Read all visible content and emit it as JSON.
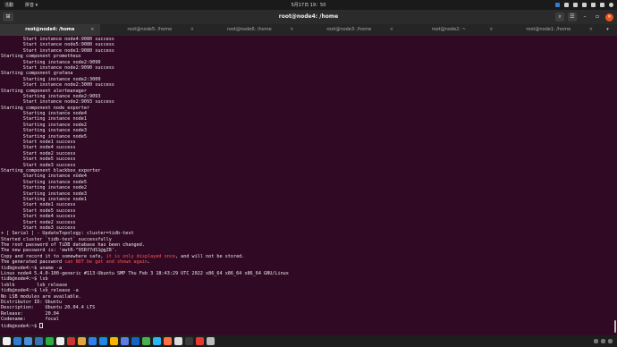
{
  "topbar": {
    "activities": "活動",
    "ime": "拼音 ▾",
    "clock": "5月17日 19：50",
    "tray_icons": [
      {
        "name": "app-tray-icon",
        "color": "#2e7fd6"
      },
      {
        "name": "chat-icon",
        "color": "#cfcfcf"
      },
      {
        "name": "wifi-icon",
        "color": "#cfcfcf"
      },
      {
        "name": "bluetooth-icon",
        "color": "#cfcfcf"
      },
      {
        "name": "volume-icon",
        "color": "#cfcfcf"
      },
      {
        "name": "battery-icon",
        "color": "#cfcfcf"
      },
      {
        "name": "power-icon",
        "color": "#cfcfcf"
      }
    ]
  },
  "window": {
    "title": "root@node4: /home",
    "new_tab_icon": "⊞",
    "search_icon": "⌕",
    "menu_icon": "☰",
    "minimize_icon": "–",
    "maximize_icon": "▫",
    "close_icon": "✕"
  },
  "tabs": [
    {
      "label": "root@node4: /home",
      "active": true
    },
    {
      "label": "root@node5: /home",
      "active": false
    },
    {
      "label": "root@node6: /home",
      "active": false
    },
    {
      "label": "root@node3: /home",
      "active": false
    },
    {
      "label": "root@node2: ~",
      "active": false
    },
    {
      "label": "root@node1: /home",
      "active": false
    }
  ],
  "tab_close_icon": "×",
  "tab_menu_icon": "▾",
  "terminal": {
    "lines": [
      [
        {
          "t": "        Start instance node4:9080 success"
        }
      ],
      [
        {
          "t": "        Start instance node5:9080 success"
        }
      ],
      [
        {
          "t": "        Start instance node1:9080 success"
        }
      ],
      [
        {
          "t": "Starting component prometheus"
        }
      ],
      [
        {
          "t": "        Starting instance node2:9090"
        }
      ],
      [
        {
          "t": "        Start instance node2:9090 success"
        }
      ],
      [
        {
          "t": "Starting component grafana"
        }
      ],
      [
        {
          "t": "        Starting instance node2:3000"
        }
      ],
      [
        {
          "t": "        Start instance node2:3000 success"
        }
      ],
      [
        {
          "t": "Starting component alertmanager"
        }
      ],
      [
        {
          "t": "        Starting instance node2:9093"
        }
      ],
      [
        {
          "t": "        Start instance node2:9093 success"
        }
      ],
      [
        {
          "t": "Starting component node_exporter"
        }
      ],
      [
        {
          "t": "        Starting instance node4"
        }
      ],
      [
        {
          "t": "        Starting instance node1"
        }
      ],
      [
        {
          "t": "        Starting instance node2"
        }
      ],
      [
        {
          "t": "        Starting instance node3"
        }
      ],
      [
        {
          "t": "        Starting instance node5"
        }
      ],
      [
        {
          "t": "        Start node1 success"
        }
      ],
      [
        {
          "t": "        Start node4 success"
        }
      ],
      [
        {
          "t": "        Start node2 success"
        }
      ],
      [
        {
          "t": "        Start node5 success"
        }
      ],
      [
        {
          "t": "        Start node3 success"
        }
      ],
      [
        {
          "t": "Starting component blackbox_exporter"
        }
      ],
      [
        {
          "t": "        Starting instance node4"
        }
      ],
      [
        {
          "t": "        Starting instance node5"
        }
      ],
      [
        {
          "t": "        Starting instance node2"
        }
      ],
      [
        {
          "t": "        Starting instance node3"
        }
      ],
      [
        {
          "t": "        Starting instance node1"
        }
      ],
      [
        {
          "t": "        Start node1 success"
        }
      ],
      [
        {
          "t": "        Start node5 success"
        }
      ],
      [
        {
          "t": "        Start node4 success"
        }
      ],
      [
        {
          "t": "        Start node2 success"
        }
      ],
      [
        {
          "t": "        Start node3 success"
        }
      ],
      [
        {
          "t": "+ [ Serial ] - UpdateTopology: cluster=tidb-test"
        }
      ],
      [
        {
          "t": "Started cluster `tidb-test` successfully"
        }
      ],
      [
        {
          "t": "The root password of TiDB database has been changed."
        }
      ],
      [
        {
          "t": "The new password is: 'ewtR-^95Rf7dS1@gZ8'."
        }
      ],
      [
        {
          "t": "Copy and record it to somewhere safe, "
        },
        {
          "t": "it is only displayed once",
          "red": true
        },
        {
          "t": ", and will not be stored."
        }
      ],
      [
        {
          "t": "The generated password "
        },
        {
          "t": "can NOT be get and shown again",
          "red": true
        },
        {
          "t": "."
        }
      ],
      [
        {
          "t": "tidb@node4:~$ uname -a"
        }
      ],
      [
        {
          "t": "Linux node4 5.4.0-100-generic #113-Ubuntu SMP Thu Feb 3 18:43:29 UTC 2022 x86_64 x86_64 x86_64 GNU/Linux"
        }
      ],
      [
        {
          "t": "tidb@node4:~$ lsb"
        }
      ],
      [
        {
          "t": "lsblk        lsb_release"
        }
      ],
      [
        {
          "t": "tidb@node4:~$ lsb_release -a"
        }
      ],
      [
        {
          "t": "No LSB modules are available."
        }
      ],
      [
        {
          "t": "Distributor ID: Ubuntu"
        }
      ],
      [
        {
          "t": "Description:    Ubuntu 20.04.4 LTS"
        }
      ],
      [
        {
          "t": "Release:        20.04"
        }
      ],
      [
        {
          "t": "Codename:       focal"
        }
      ],
      [
        {
          "t": "tidb@node4:~$ "
        },
        {
          "cursor": true
        }
      ]
    ]
  },
  "taskbar": {
    "apps": [
      {
        "name": "start-menu-icon",
        "color": "#f0f0f0"
      },
      {
        "name": "windows-icon",
        "color": "#2d7dd2"
      },
      {
        "name": "files-icon",
        "color": "#4a90d9"
      },
      {
        "name": "mail-icon",
        "color": "#3c6fb0"
      },
      {
        "name": "wechat-icon",
        "color": "#2bae3c"
      },
      {
        "name": "qq-icon",
        "color": "#eeeeee"
      },
      {
        "name": "app-icon",
        "color": "#cc3333"
      },
      {
        "name": "folder-icon",
        "color": "#e6a23c"
      },
      {
        "name": "code-icon",
        "color": "#2f80ed"
      },
      {
        "name": "app-icon",
        "color": "#1e88e5"
      },
      {
        "name": "chrome-icon",
        "color": "#f4b400"
      },
      {
        "name": "app-icon",
        "color": "#5e7ce2"
      },
      {
        "name": "app-icon",
        "color": "#1565c0"
      },
      {
        "name": "app-icon",
        "color": "#4caf50"
      },
      {
        "name": "app-icon",
        "color": "#29b6f6"
      },
      {
        "name": "app-icon",
        "color": "#ff7043"
      },
      {
        "name": "app-icon",
        "color": "#dddddd"
      },
      {
        "name": "terminal-icon",
        "color": "#3a3a3a"
      },
      {
        "name": "app-icon",
        "color": "#e53935"
      },
      {
        "name": "app-icon",
        "color": "#bbbbbb"
      }
    ],
    "tray": [
      {
        "name": "tray-icon",
        "color": "#777777"
      },
      {
        "name": "tray-icon",
        "color": "#777777"
      },
      {
        "name": "tray-icon",
        "color": "#777777"
      }
    ]
  }
}
